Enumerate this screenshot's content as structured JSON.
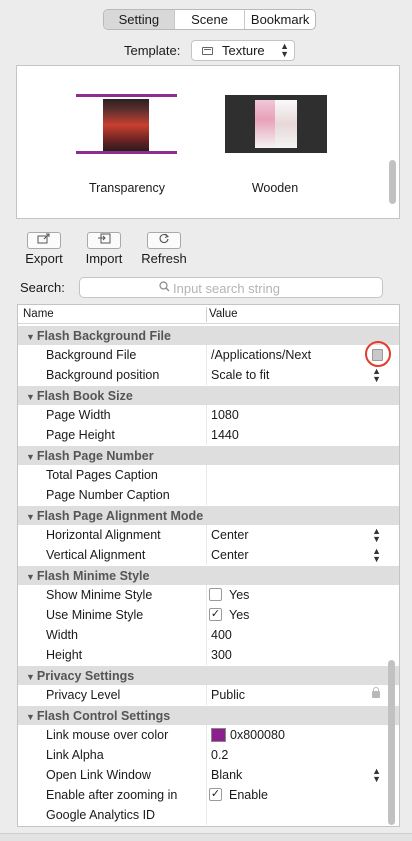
{
  "tabs": [
    {
      "label": "Setting",
      "active": true
    },
    {
      "label": "Scene",
      "active": false
    },
    {
      "label": "Bookmark",
      "active": false
    }
  ],
  "template": {
    "label": "Template:",
    "selected": "Texture"
  },
  "preview": {
    "items": [
      {
        "label": "Transparency"
      },
      {
        "label": "Wooden"
      }
    ]
  },
  "actions": [
    {
      "label": "Export",
      "icon": "export-icon"
    },
    {
      "label": "Import",
      "icon": "import-icon"
    },
    {
      "label": "Refresh",
      "icon": "refresh-icon"
    }
  ],
  "search": {
    "label": "Search:",
    "placeholder": "Input search string",
    "value": ""
  },
  "grid": {
    "columns": [
      "Name",
      "Value"
    ],
    "categories": [
      {
        "title": "Flash Background File",
        "rows": [
          {
            "name": "Background File",
            "value": "/Applications/Next"
          },
          {
            "name": "Background position",
            "value": "Scale to fit"
          }
        ]
      },
      {
        "title": "Flash Book Size",
        "rows": [
          {
            "name": "Page Width",
            "value": "1080"
          },
          {
            "name": "Page Height",
            "value": "1440"
          }
        ]
      },
      {
        "title": "Flash Page Number",
        "rows": [
          {
            "name": "Total Pages Caption",
            "value": ""
          },
          {
            "name": "Page Number Caption",
            "value": ""
          }
        ]
      },
      {
        "title": "Flash Page Alignment  Mode",
        "rows": [
          {
            "name": "Horizontal Alignment",
            "value": "Center"
          },
          {
            "name": "Vertical Alignment",
            "value": "Center"
          }
        ]
      },
      {
        "title": "Flash Minime Style",
        "rows": [
          {
            "name": "Show Minime Style",
            "value": "Yes",
            "checked": false
          },
          {
            "name": "Use Minime Style",
            "value": "Yes",
            "checked": true
          },
          {
            "name": "Width",
            "value": "400"
          },
          {
            "name": "Height",
            "value": "300"
          }
        ]
      },
      {
        "title": "Privacy Settings",
        "rows": [
          {
            "name": "Privacy Level",
            "value": "Public"
          }
        ]
      },
      {
        "title": "Flash Control Settings",
        "rows": [
          {
            "name": "Link mouse over color",
            "value": "0x800080",
            "color": "#8e1f8e"
          },
          {
            "name": "Link Alpha",
            "value": "0.2"
          },
          {
            "name": "Open Link Window",
            "value": "Blank"
          },
          {
            "name": "Enable after zooming in",
            "value": "Enable",
            "checked": true
          },
          {
            "name": "Google Analytics ID",
            "value": ""
          }
        ]
      }
    ]
  },
  "colors": {
    "highlight_ring": "#e53b2c",
    "category_bg": "#dedede",
    "link_color_swatch": "#8e1f8e"
  }
}
